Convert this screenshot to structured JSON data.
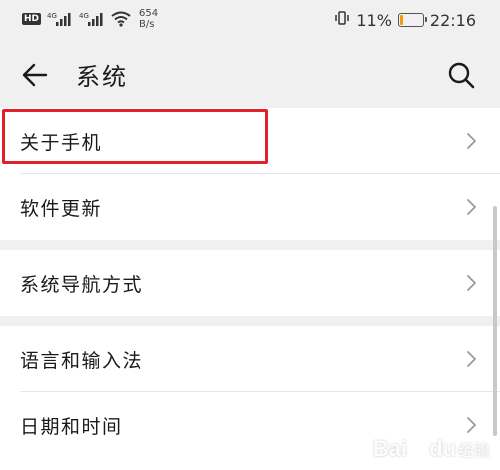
{
  "status_bar": {
    "hd_badge": "HD",
    "signal1_label": "4G",
    "signal2_label": "4G",
    "net_speed_value": "654",
    "net_speed_unit": "B/s",
    "battery_text": "11%",
    "battery_level": 0.11,
    "time": "22:16",
    "battery_color": "#f39c12"
  },
  "app_bar": {
    "title": "系统",
    "back_icon": "arrow-left-icon",
    "search_icon": "search-icon"
  },
  "groups": [
    {
      "items": [
        {
          "label": "关于手机",
          "highlighted": true
        },
        {
          "label": "软件更新"
        }
      ]
    },
    {
      "items": [
        {
          "label": "系统导航方式"
        }
      ]
    },
    {
      "items": [
        {
          "label": "语言和输入法"
        },
        {
          "label": "日期和时间"
        }
      ]
    }
  ],
  "highlight_color": "#e0212b",
  "watermark": {
    "brand": "Bai",
    "brand2": "du",
    "sub": "经验"
  }
}
